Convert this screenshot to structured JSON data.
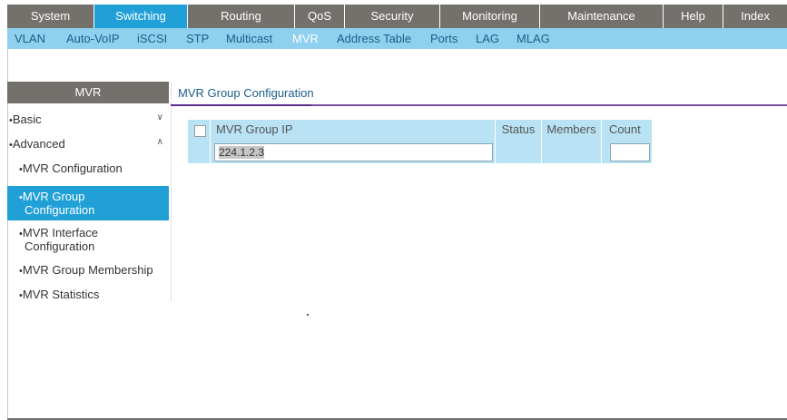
{
  "topnav": {
    "tabs": [
      {
        "label": "System"
      },
      {
        "label": "Switching"
      },
      {
        "label": "Routing"
      },
      {
        "label": "QoS"
      },
      {
        "label": "Security"
      },
      {
        "label": "Monitoring"
      },
      {
        "label": "Maintenance"
      },
      {
        "label": "Help"
      },
      {
        "label": "Index"
      }
    ],
    "active": "Switching"
  },
  "subnav": {
    "items": [
      {
        "label": "VLAN"
      },
      {
        "label": "Auto-VoIP"
      },
      {
        "label": "iSCSI"
      },
      {
        "label": "STP"
      },
      {
        "label": "Multicast"
      },
      {
        "label": "MVR"
      },
      {
        "label": "Address Table"
      },
      {
        "label": "Ports"
      },
      {
        "label": "LAG"
      },
      {
        "label": "MLAG"
      }
    ],
    "active": "MVR"
  },
  "sidebar": {
    "header": "MVR",
    "bullet": "•",
    "items": [
      {
        "label": "Basic",
        "chevron": "∨"
      },
      {
        "label": "Advanced",
        "chevron": "∧"
      },
      {
        "label": "MVR Configuration"
      },
      {
        "label": "MVR Group Configuration",
        "line1": "MVR Group",
        "line2": "Configuration"
      },
      {
        "label": "MVR Interface Configuration",
        "line1": "MVR Interface",
        "line2": "Configuration"
      },
      {
        "label": "MVR Group Membership"
      },
      {
        "label": "MVR Statistics"
      }
    ],
    "active": "MVR Group Configuration"
  },
  "main": {
    "title": "MVR Group Configuration",
    "table": {
      "headers": [
        "MVR Group IP",
        "Status",
        "Members",
        "Count"
      ],
      "row": {
        "group_ip": "224.1.2.3",
        "status": "",
        "members": "",
        "count": ""
      }
    }
  },
  "colors": {
    "nav_bg": "#74706b",
    "accent": "#21a0d8",
    "subnav_bg": "#8fd0ee",
    "grid_bg": "#b9e3f4",
    "title_underline": "#7a4ea5"
  }
}
